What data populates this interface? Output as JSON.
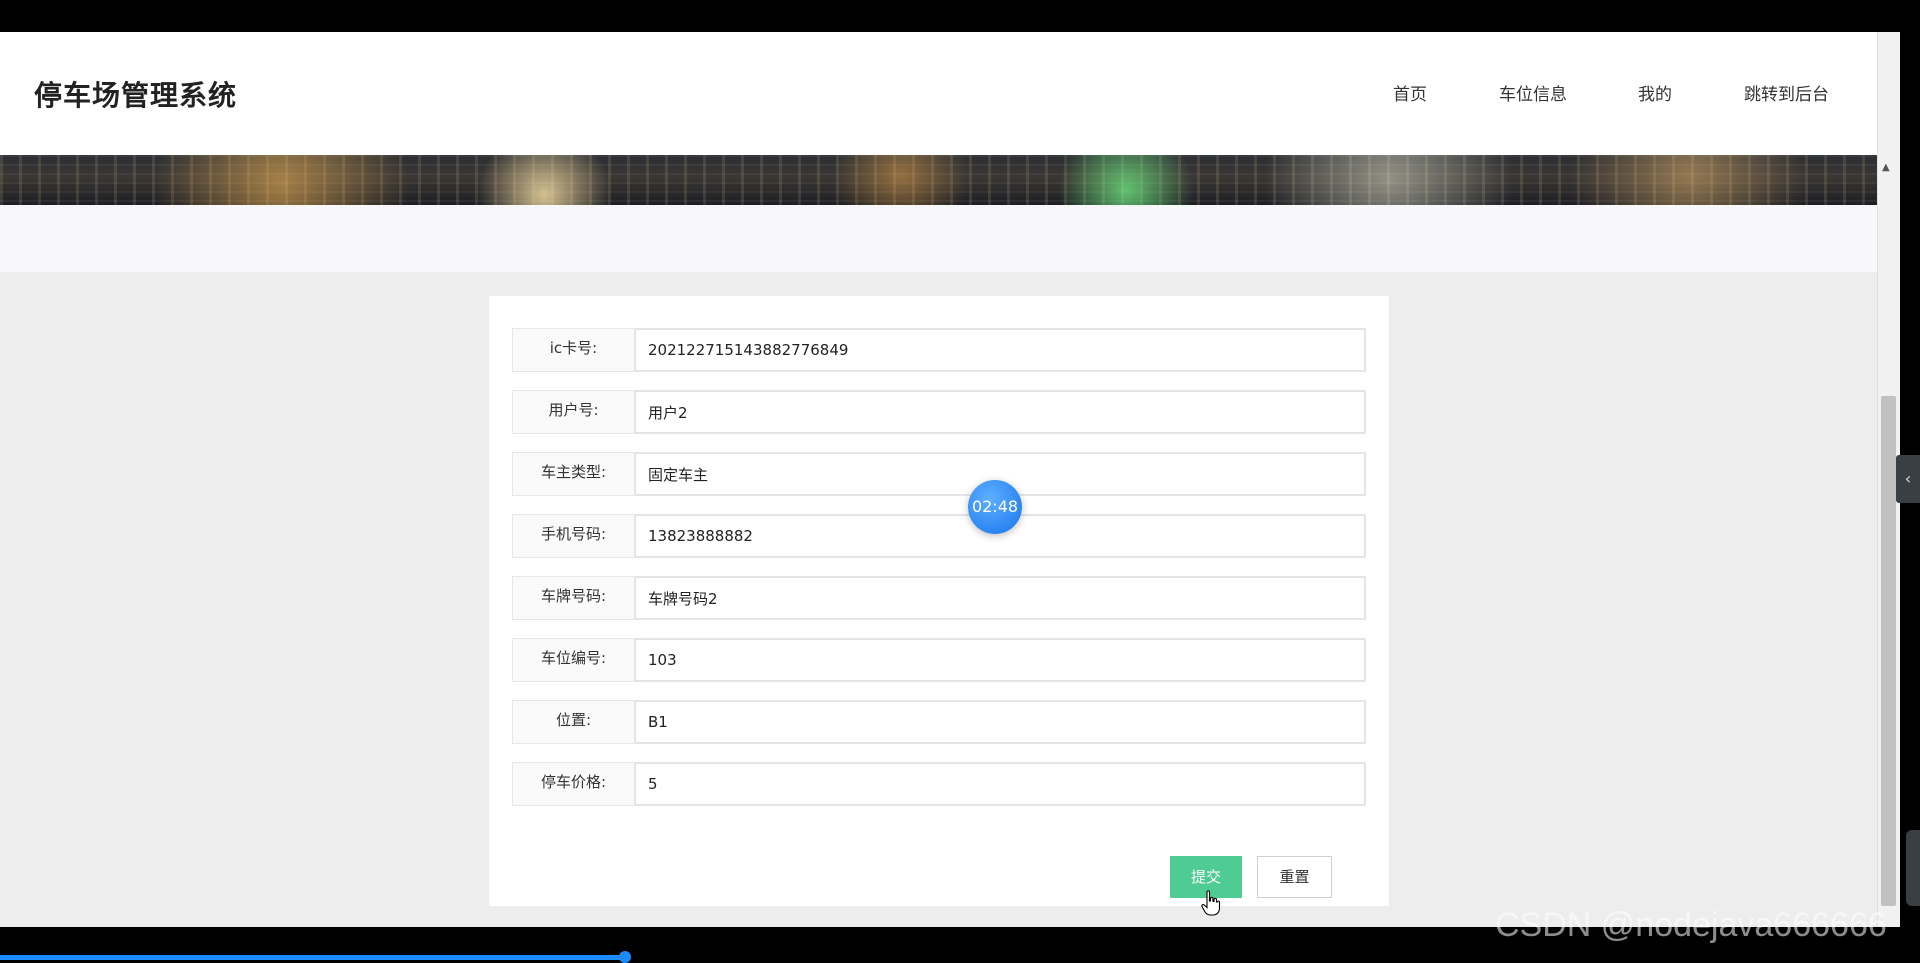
{
  "header": {
    "title": "停车场管理系统",
    "nav": [
      "首页",
      "车位信息",
      "我的",
      "跳转到后台"
    ]
  },
  "form": {
    "fields": [
      {
        "label": "ic卡号:",
        "value": "202122715143882776849"
      },
      {
        "label": "用户号:",
        "value": "用户2"
      },
      {
        "label": "车主类型:",
        "value": "固定车主"
      },
      {
        "label": "手机号码:",
        "value": "13823888882"
      },
      {
        "label": "车牌号码:",
        "value": "车牌号码2"
      },
      {
        "label": "车位编号:",
        "value": "103"
      },
      {
        "label": "位置:",
        "value": "B1"
      },
      {
        "label": "停车价格:",
        "value": "5"
      }
    ],
    "submit_label": "提交",
    "reset_label": "重置"
  },
  "overlay": {
    "timer": "02:48",
    "watermark": "CSDN @nodejava666666"
  },
  "colors": {
    "accent": "#4fcb94",
    "timer": "#2c86f2",
    "background": "#ededed"
  }
}
